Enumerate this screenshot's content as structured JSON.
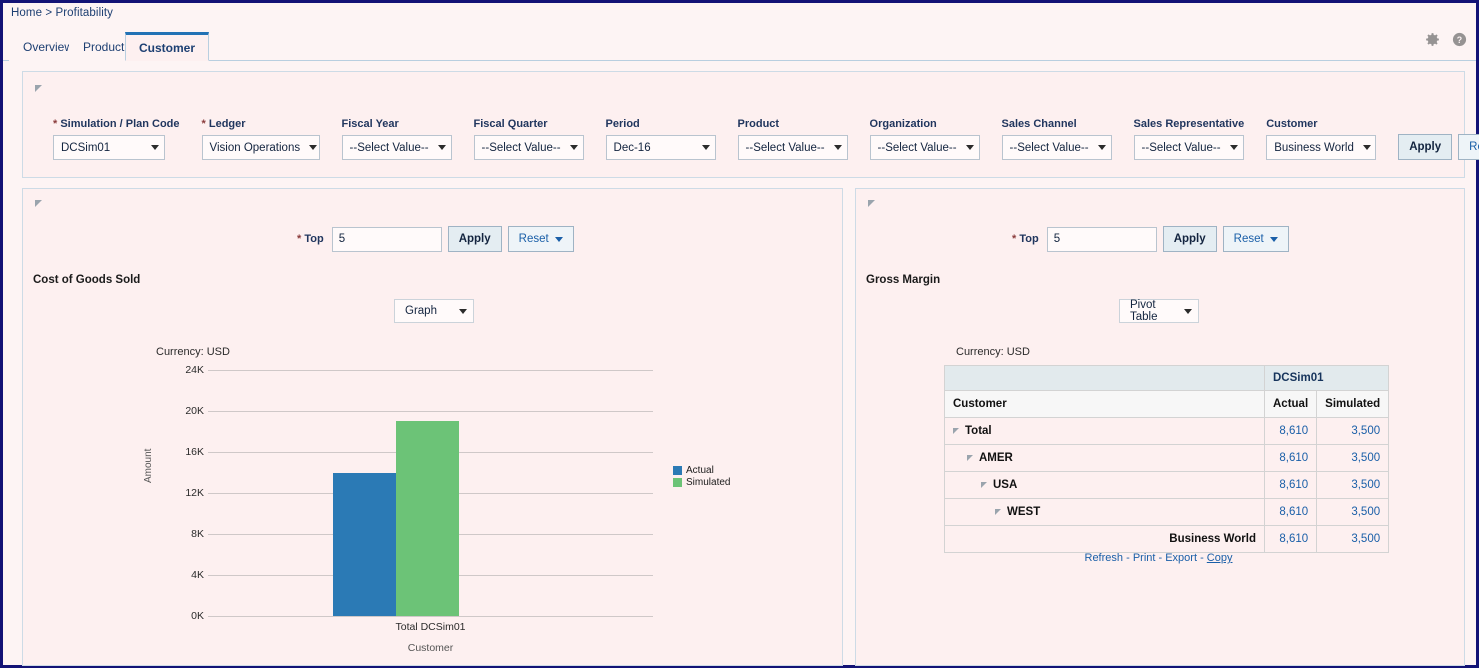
{
  "breadcrumb": "Home > Profitability",
  "tabs": [
    {
      "label": "Overview",
      "active": false
    },
    {
      "label": "Product",
      "active": false
    },
    {
      "label": "Customer",
      "active": true
    }
  ],
  "header_icons": [
    {
      "name": "gear-icon"
    },
    {
      "name": "help-icon"
    }
  ],
  "filters": [
    {
      "label": "Simulation / Plan Code",
      "required": true,
      "value": "DCSim01",
      "width": 112
    },
    {
      "label": "Ledger",
      "required": true,
      "value": "Vision Operations",
      "width": 118
    },
    {
      "label": "Fiscal Year",
      "required": false,
      "value": "--Select Value--",
      "width": 110
    },
    {
      "label": "Fiscal Quarter",
      "required": false,
      "value": "--Select Value--",
      "width": 110
    },
    {
      "label": "Period",
      "required": false,
      "value": "Dec-16",
      "width": 110
    },
    {
      "label": "Product",
      "required": false,
      "value": "--Select Value--",
      "width": 110
    },
    {
      "label": "Organization",
      "required": false,
      "value": "--Select Value--",
      "width": 110
    },
    {
      "label": "Sales Channel",
      "required": false,
      "value": "--Select Value--",
      "width": 110
    },
    {
      "label": "Sales Representative",
      "required": false,
      "value": "--Select Value--",
      "width": 110
    },
    {
      "label": "Customer",
      "required": false,
      "value": "Business World",
      "width": 110
    }
  ],
  "filter_actions": {
    "apply_label": "Apply",
    "reset_label": "Reset"
  },
  "left_panel": {
    "top_label": "Top",
    "top_value": "5",
    "top_placeholder": "",
    "apply_label": "Apply",
    "reset_label": "Reset",
    "section_title": "Cost of Goods Sold",
    "view_selector": "Graph",
    "currency": "Currency: USD"
  },
  "right_panel": {
    "top_label": "Top",
    "top_value": "5",
    "top_placeholder": "",
    "apply_label": "Apply",
    "reset_label": "Reset",
    "section_title": "Gross Margin",
    "view_selector": "Pivot Table",
    "currency": "Currency: USD",
    "table": {
      "group_header": "DCSim01",
      "col_customer": "Customer",
      "col_actual": "Actual",
      "col_simulated": "Simulated",
      "rows": [
        {
          "label": "Total",
          "indent": 0,
          "expandable": true,
          "right_aligned": false,
          "actual": "8,610",
          "simulated": "3,500"
        },
        {
          "label": "AMER",
          "indent": 1,
          "expandable": true,
          "right_aligned": false,
          "actual": "8,610",
          "simulated": "3,500"
        },
        {
          "label": "USA",
          "indent": 2,
          "expandable": true,
          "right_aligned": false,
          "actual": "8,610",
          "simulated": "3,500"
        },
        {
          "label": "WEST",
          "indent": 3,
          "expandable": true,
          "right_aligned": false,
          "actual": "8,610",
          "simulated": "3,500"
        },
        {
          "label": "Business World",
          "indent": 0,
          "expandable": false,
          "right_aligned": true,
          "actual": "8,610",
          "simulated": "3,500"
        }
      ]
    },
    "links": [
      {
        "label": "Refresh",
        "hover": false
      },
      {
        "label": "Print",
        "hover": false
      },
      {
        "label": "Export",
        "hover": false
      },
      {
        "label": "Copy",
        "hover": true
      }
    ],
    "link_separator": "-"
  },
  "colors": {
    "actual": "#2b7ab5",
    "simulated": "#6cc377",
    "panel_bg": "#fdf0f0",
    "page_bg": "#fdf4f4",
    "frame": "#131376",
    "tab_active_border": "#2272b5",
    "link": "#1a5fa8"
  },
  "chart_data": {
    "type": "bar",
    "title": "Cost of Goods Sold",
    "xlabel": "Customer",
    "ylabel": "Amount",
    "categories": [
      "Total DCSim01"
    ],
    "series": [
      {
        "name": "Actual",
        "values": [
          14000
        ],
        "color": "#2b7ab5"
      },
      {
        "name": "Simulated",
        "values": [
          19000
        ],
        "color": "#6cc377"
      }
    ],
    "ylim": [
      0,
      24000
    ],
    "ytick_values": [
      0,
      4000,
      8000,
      12000,
      16000,
      20000,
      24000
    ],
    "ytick_labels": [
      "0K",
      "4K",
      "8K",
      "12K",
      "16K",
      "20K",
      "24K"
    ],
    "grid": true,
    "legend_position": "right",
    "currency": "USD"
  }
}
